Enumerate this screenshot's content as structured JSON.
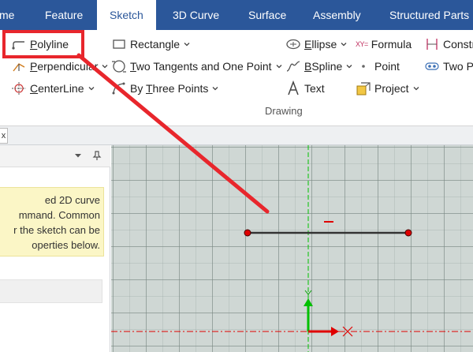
{
  "tabs": [
    {
      "label": "me",
      "active": false
    },
    {
      "label": "Feature",
      "active": false
    },
    {
      "label": "Sketch",
      "active": true
    },
    {
      "label": "3D Curve",
      "active": false
    },
    {
      "label": "Surface",
      "active": false
    },
    {
      "label": "Assembly",
      "active": false
    },
    {
      "label": "Structured Parts",
      "active": false
    }
  ],
  "ribbon": {
    "polyline": {
      "accel": "P",
      "rest": "olyline"
    },
    "perpendicular": {
      "accel": "P",
      "rest": "erpendicular"
    },
    "centerline": {
      "accel": "C",
      "rest": "enterLine"
    },
    "rectangle": "Rectangle",
    "two_tangents": {
      "accel": "T",
      "rest": "wo Tangents and One Point"
    },
    "three_points": {
      "before": "By ",
      "accel": "T",
      "rest": "hree Points"
    },
    "ellipse": {
      "accel": "E",
      "rest": "llipse"
    },
    "bspline": {
      "accel": "B",
      "rest": "Spline"
    },
    "text": "Text",
    "formula_glyph": "XY=",
    "formula": "Formula",
    "point": "Point",
    "project": "Project",
    "constraint_partial": "Constr",
    "two_partial": "Two Po",
    "group_label": "Drawing"
  },
  "doc_tab_close": "x",
  "panel": {
    "hint_lines": [
      "ed 2D curve",
      "mmand. Common",
      "r the sketch can be",
      "operties below."
    ]
  },
  "colors": {
    "tab_bar": "#2b579a",
    "canvas": "#cfd7d4",
    "highlight": "#e8262c",
    "axis_green": "#00c000",
    "axis_red": "#e00000"
  }
}
